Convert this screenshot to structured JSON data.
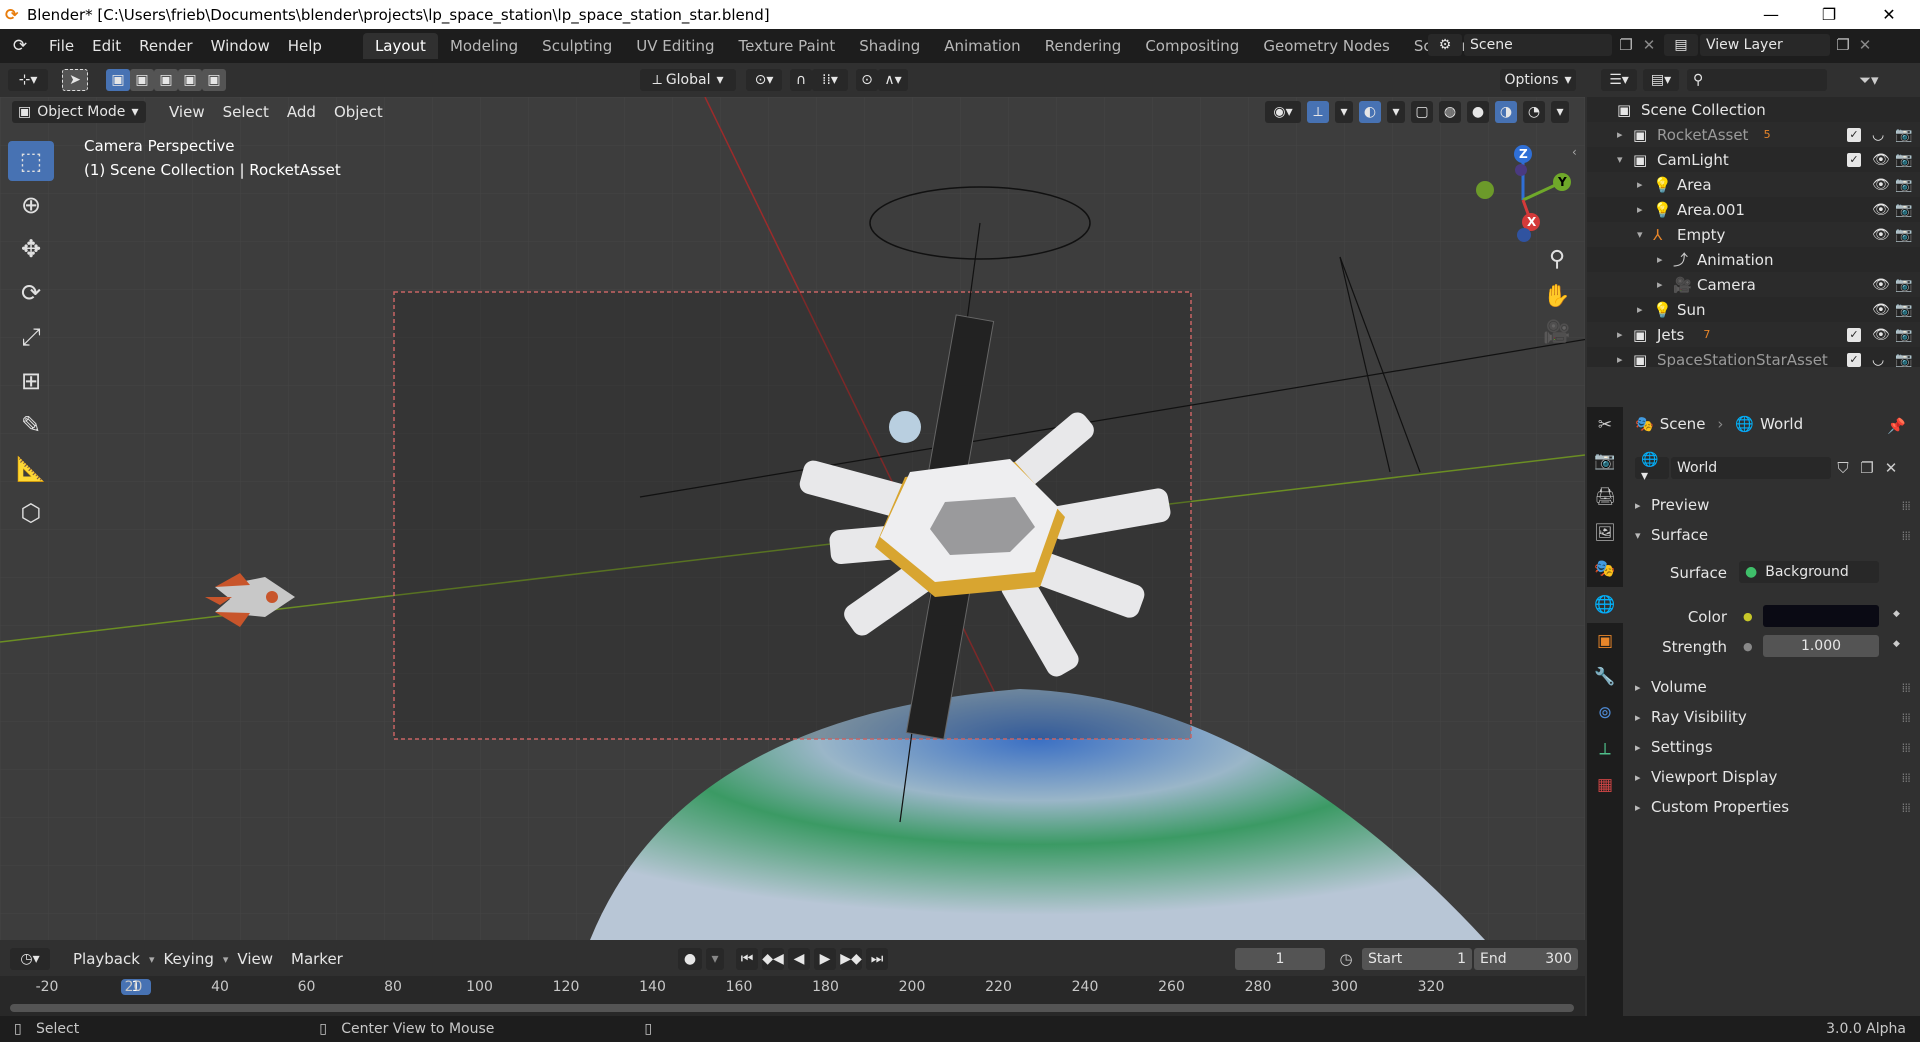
{
  "window": {
    "title": "Blender* [C:\\Users\\frieb\\Documents\\blender\\projects\\lp_space_station\\lp_space_station_star.blend]",
    "minimize": "—",
    "maximize": "❐",
    "close": "✕"
  },
  "menu": [
    "File",
    "Edit",
    "Render",
    "Window",
    "Help"
  ],
  "workspaces": [
    "Layout",
    "Modeling",
    "Sculpting",
    "UV Editing",
    "Texture Paint",
    "Shading",
    "Animation",
    "Rendering",
    "Compositing",
    "Geometry Nodes",
    "Scripting"
  ],
  "active_workspace": "Layout",
  "add_workspace": "+",
  "scene_name": "Scene",
  "view_layer": "View Layer",
  "header": {
    "orientation": "Global",
    "options": "Options"
  },
  "viewport_header": {
    "mode": "Object Mode",
    "menus": [
      "View",
      "Select",
      "Add",
      "Object"
    ]
  },
  "viewport": {
    "perspective_label": "Camera Perspective",
    "collection_label": "(1) Scene Collection | RocketAsset"
  },
  "gizmo": {
    "z": "Z",
    "y": "Y",
    "x": "X"
  },
  "outliner": {
    "root": "Scene Collection",
    "rows": [
      {
        "name": "RocketAsset",
        "badge": "5",
        "dimmed": true,
        "level": 1
      },
      {
        "name": "CamLight",
        "level": 1
      },
      {
        "name": "Area",
        "level": 2
      },
      {
        "name": "Area.001",
        "level": 2
      },
      {
        "name": "Empty",
        "level": 2
      },
      {
        "name": "Animation",
        "level": 3
      },
      {
        "name": "Camera",
        "level": 3
      },
      {
        "name": "Sun",
        "level": 2
      },
      {
        "name": "Jets",
        "badge": "7",
        "level": 1
      },
      {
        "name": "SpaceStationStarAsset",
        "dimmed": true,
        "level": 1
      }
    ]
  },
  "properties": {
    "breadcrumb_scene": "Scene",
    "breadcrumb_world": "World",
    "world_name": "World",
    "panels": {
      "preview": "Preview",
      "surface": "Surface",
      "volume": "Volume",
      "ray_visibility": "Ray Visibility",
      "settings": "Settings",
      "viewport_display": "Viewport Display",
      "custom_properties": "Custom Properties"
    },
    "surface_label": "Surface",
    "surface_value": "Background",
    "color_label": "Color",
    "strength_label": "Strength",
    "strength_value": "1.000"
  },
  "timeline": {
    "menus": [
      "Playback",
      "Keying",
      "View",
      "Marker"
    ],
    "current_frame": "1",
    "start_label": "Start",
    "start_value": "1",
    "end_label": "End",
    "end_value": "300",
    "ruler": [
      "-20",
      "1",
      "20",
      "40",
      "60",
      "80",
      "100",
      "120",
      "140",
      "160",
      "180",
      "200",
      "220",
      "240",
      "260",
      "280",
      "300",
      "320"
    ]
  },
  "status": {
    "select": "Select",
    "center": "Center View to Mouse",
    "version": "3.0.0 Alpha"
  },
  "colors": {
    "accent": "#4772b3",
    "header": "#303030",
    "dark": "#1d1d1d",
    "viewport": "#3d3d3d"
  }
}
